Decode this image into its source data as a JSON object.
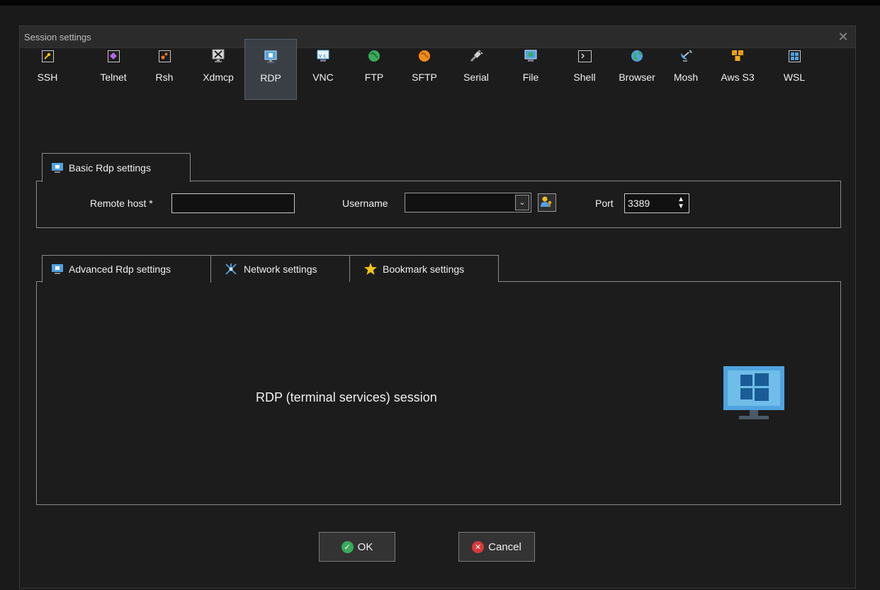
{
  "window": {
    "title": "Session settings",
    "close_glyph": "✕"
  },
  "protocols": [
    {
      "label": "SSH",
      "icon": "key-icon",
      "active": false
    },
    {
      "label": "Telnet",
      "icon": "telnet-icon",
      "active": false
    },
    {
      "label": "Rsh",
      "icon": "rsh-gears-icon",
      "active": false
    },
    {
      "label": "Xdmcp",
      "icon": "xdmcp-icon",
      "active": false
    },
    {
      "label": "RDP",
      "icon": "rdp-monitor-icon",
      "active": true
    },
    {
      "label": "VNC",
      "icon": "vnc-icon",
      "active": false
    },
    {
      "label": "FTP",
      "icon": "ftp-globe-icon",
      "active": false
    },
    {
      "label": "SFTP",
      "icon": "sftp-globe-icon",
      "active": false
    },
    {
      "label": "Serial",
      "icon": "serial-plug-icon",
      "active": false
    },
    {
      "label": "File",
      "icon": "file-monitor-icon",
      "active": false
    },
    {
      "label": "Shell",
      "icon": "shell-prompt-icon",
      "active": false
    },
    {
      "label": "Browser",
      "icon": "browser-globe-icon",
      "active": false
    },
    {
      "label": "Mosh",
      "icon": "satellite-dish-icon",
      "active": false
    },
    {
      "label": "Aws S3",
      "icon": "aws-cubes-icon",
      "active": false
    },
    {
      "label": "WSL",
      "icon": "windows-icon",
      "active": false
    }
  ],
  "basic": {
    "tab_label": "Basic Rdp settings",
    "remote_host_label": "Remote host *",
    "remote_host_value": "",
    "username_label": "Username",
    "username_value": "",
    "port_label": "Port",
    "port_value": "3389"
  },
  "advanced_tabs": [
    {
      "label": "Advanced Rdp settings",
      "icon": "monitor-icon"
    },
    {
      "label": "Network settings",
      "icon": "network-icon"
    },
    {
      "label": "Bookmark settings",
      "icon": "star-icon"
    }
  ],
  "session_description": "RDP (terminal services) session",
  "buttons": {
    "ok": "OK",
    "cancel": "Cancel"
  },
  "colors": {
    "accent_blue": "#4fa3e0",
    "ok_green": "#3aaa5a",
    "cancel_red": "#d9383a",
    "star_yellow": "#f2c21b"
  }
}
